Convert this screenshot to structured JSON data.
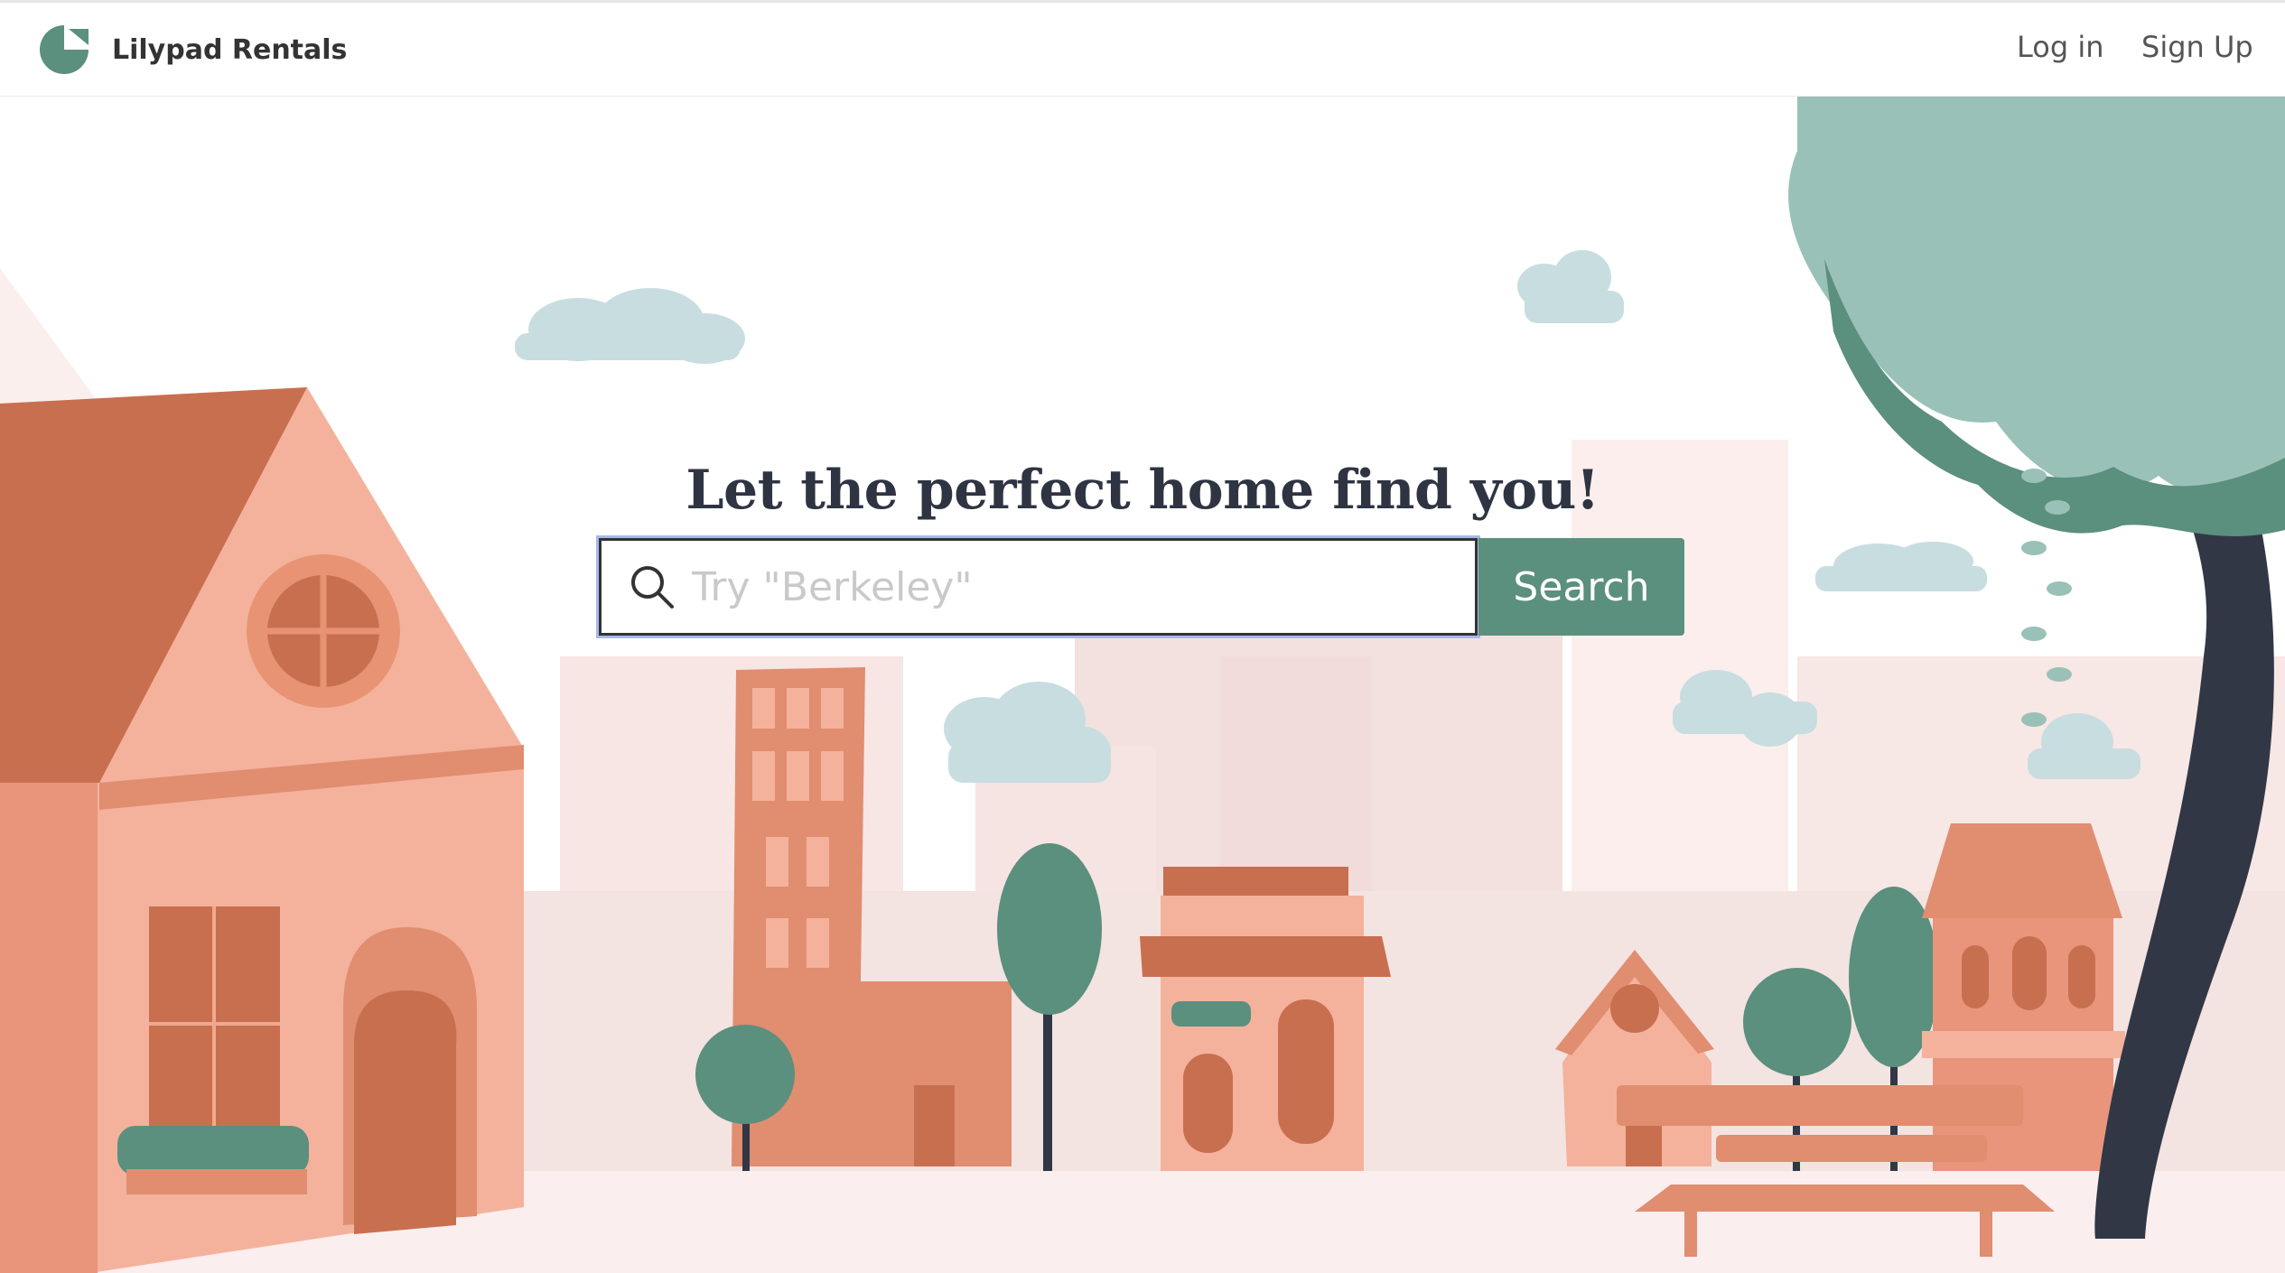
{
  "header": {
    "brand_name": "Lilypad Rentals",
    "logo_icon": "lilypad-leaf-icon",
    "login_label": "Log in",
    "signup_label": "Sign Up"
  },
  "hero": {
    "headline": "Let the perfect home find you!",
    "search": {
      "placeholder": "Try \"Berkeley\"",
      "value": "",
      "icon": "search-icon",
      "button_label": "Search"
    }
  },
  "colors": {
    "brand_green": "#5b8f7e",
    "headline_text": "#2f3442",
    "house_pink": "#f4b29c",
    "house_terracotta": "#c86f50",
    "tree_light_green": "#9ac1b7",
    "tree_trunk": "#323746",
    "cloud": "#c8dde0"
  }
}
